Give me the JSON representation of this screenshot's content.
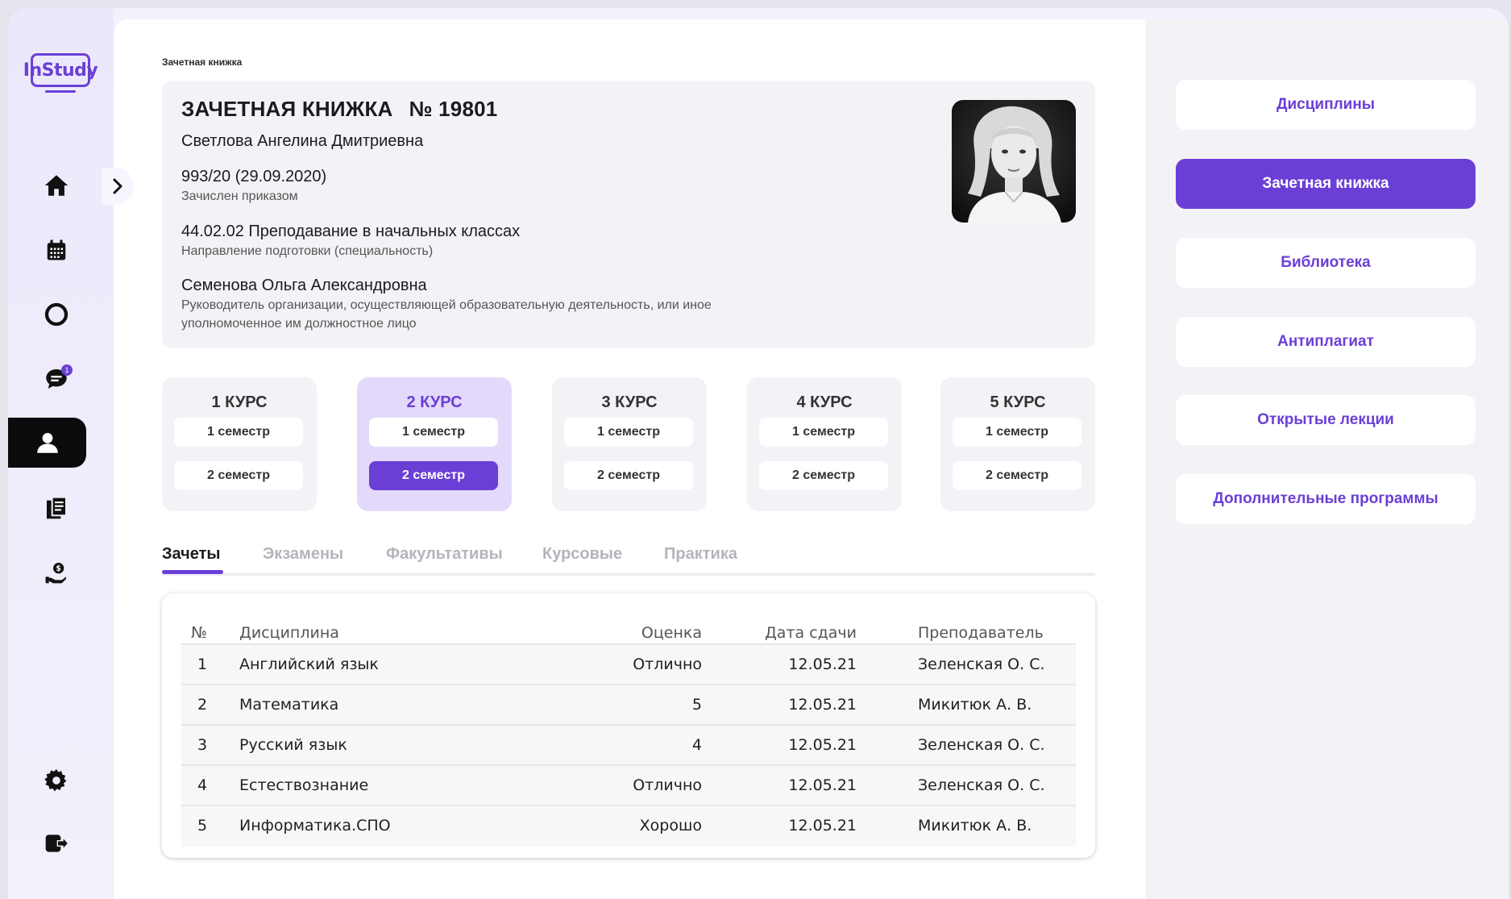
{
  "brand": {
    "logo_text": "InStudy",
    "accent": "#6b3fd6"
  },
  "sidebar": {
    "icons": [
      "home-icon",
      "calendar-icon",
      "circle-icon",
      "chat-icon",
      "profile-icon",
      "documents-icon",
      "support-icon",
      "settings-icon",
      "logout-icon"
    ],
    "chat_badge": "1",
    "collapse_icon": "chevron-right-icon"
  },
  "breadcrumb": "Зачетная книжка",
  "record": {
    "title": "ЗАЧЕТНАЯ КНИЖКА",
    "number": "№ 19801",
    "student_name": "Светлова Ангелина Дмитриевна",
    "order_value": "993/20 (29.09.2020)",
    "order_caption": "Зачислен приказом",
    "direction_value": "44.02.02 Преподавание в начальных классах",
    "direction_caption": "Направление подготовки (специальность)",
    "head_value": "Семенова Ольга Александровна",
    "head_caption": "Руководитель организации, осуществляющей образовательную деятельность, или иное уполномоченное им должностное лицо"
  },
  "courses": [
    {
      "title": "1 КУРС",
      "sem1": "1 семестр",
      "sem2": "2 семестр"
    },
    {
      "title": "2 КУРС",
      "sem1": "1 семестр",
      "sem2": "2 семестр",
      "active": true,
      "selected_semester": 2
    },
    {
      "title": "3 КУРС",
      "sem1": "1 семестр",
      "sem2": "2 семестр"
    },
    {
      "title": "4 КУРС",
      "sem1": "1 семестр",
      "sem2": "2 семестр"
    },
    {
      "title": "5 КУРС",
      "sem1": "1 семестр",
      "sem2": "2 семестр"
    }
  ],
  "tabs": [
    {
      "label": "Зачеты",
      "active": true
    },
    {
      "label": "Экзамены"
    },
    {
      "label": "Факультативы"
    },
    {
      "label": "Курсовые"
    },
    {
      "label": "Практика"
    }
  ],
  "table": {
    "headers": {
      "num": "№",
      "discipline": "Дисциплина",
      "grade": "Оценка",
      "date": "Дата сдачи",
      "teacher": "Преподаватель"
    },
    "rows": [
      {
        "num": "1",
        "discipline": "Английский язык",
        "grade": "Отлично",
        "date": "12.05.21",
        "teacher": "Зеленская О. С."
      },
      {
        "num": "2",
        "discipline": "Математика",
        "grade": "5",
        "date": "12.05.21",
        "teacher": "Микитюк А. В."
      },
      {
        "num": "3",
        "discipline": "Русский язык",
        "grade": "4",
        "date": "12.05.21",
        "teacher": "Зеленская О. С."
      },
      {
        "num": "4",
        "discipline": "Естествознание",
        "grade": "Отлично",
        "date": "12.05.21",
        "teacher": "Зеленская О. С."
      },
      {
        "num": "5",
        "discipline": "Информатика.СПО",
        "grade": "Хорошо",
        "date": "12.05.21",
        "teacher": "Микитюк А. В."
      }
    ]
  },
  "right_menu": [
    {
      "label": "Дисциплины"
    },
    {
      "label": "Зачетная книжка",
      "active": true
    },
    {
      "label": "Библиотека"
    },
    {
      "label": "Антиплагиат"
    },
    {
      "label": "Открытые лекции"
    },
    {
      "label": "Дополнительные программы"
    }
  ]
}
